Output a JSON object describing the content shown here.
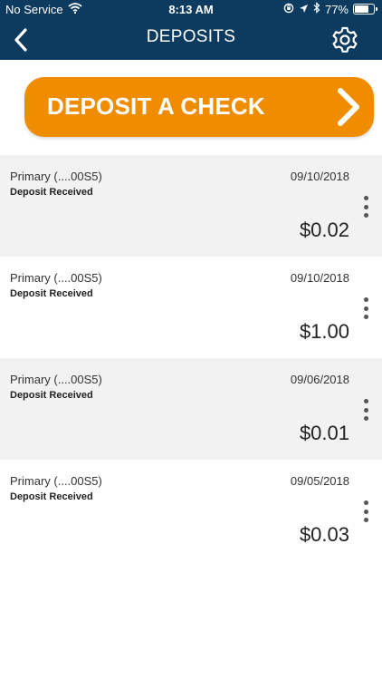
{
  "status_bar": {
    "carrier": "No Service",
    "time": "8:13 AM",
    "battery": "77%",
    "battery_level": 0.77
  },
  "header": {
    "title": "DEPOSITS"
  },
  "deposit_button": {
    "label": "DEPOSIT A CHECK"
  },
  "colors": {
    "header_bg": "#0d3a5f",
    "accent": "#f08c00"
  },
  "deposits": [
    {
      "account": "Primary (....00S5)",
      "status": "Deposit Received",
      "date": "09/10/2018",
      "amount": "$0.02"
    },
    {
      "account": "Primary (....00S5)",
      "status": "Deposit Received",
      "date": "09/10/2018",
      "amount": "$1.00"
    },
    {
      "account": "Primary (....00S5)",
      "status": "Deposit Received",
      "date": "09/06/2018",
      "amount": "$0.01"
    },
    {
      "account": "Primary (....00S5)",
      "status": "Deposit Received",
      "date": "09/05/2018",
      "amount": "$0.03"
    }
  ]
}
